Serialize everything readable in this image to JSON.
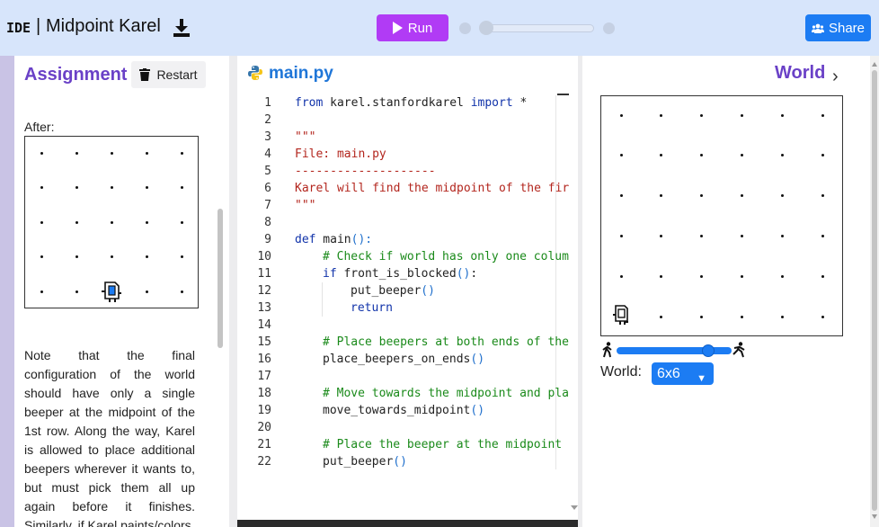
{
  "header": {
    "ide_label": "IDE",
    "separator": "|",
    "project_title": "Midpoint Karel",
    "run_label": "Run",
    "share_label": "Share"
  },
  "assignment": {
    "title": "Assignment",
    "restart_label": "Restart",
    "after_label": "After:",
    "after_world": {
      "cols": 5,
      "rows": 5,
      "karel_col": 3,
      "karel_row": 1,
      "karel_direction": "east",
      "beeper_col": 3,
      "beeper_row": 1
    },
    "text": "Note that the final configuration of the world should have only a single beeper at the midpoint of the 1st row. Along the way, Karel is allowed to place additional beepers wherever it wants to, but must pick them all up again before it finishes. Similarly, if Karel paints/colors"
  },
  "editor": {
    "file_name": "main.py",
    "lines": [
      {
        "n": "1",
        "indent": 0,
        "tokens": [
          [
            "kw",
            "from"
          ],
          [
            "tx",
            " karel.stanfordkarel "
          ],
          [
            "kw",
            "import"
          ],
          [
            "tx",
            " *"
          ]
        ]
      },
      {
        "n": "2",
        "indent": 0,
        "tokens": []
      },
      {
        "n": "3",
        "indent": 0,
        "tokens": [
          [
            "str",
            "\"\"\""
          ]
        ]
      },
      {
        "n": "4",
        "indent": 0,
        "tokens": [
          [
            "str",
            "File: main.py"
          ]
        ]
      },
      {
        "n": "5",
        "indent": 0,
        "tokens": [
          [
            "str",
            "--------------------"
          ]
        ]
      },
      {
        "n": "6",
        "indent": 0,
        "tokens": [
          [
            "str",
            "Karel will find the midpoint of the firs"
          ]
        ]
      },
      {
        "n": "7",
        "indent": 0,
        "tokens": [
          [
            "str",
            "\"\"\""
          ]
        ]
      },
      {
        "n": "8",
        "indent": 0,
        "tokens": []
      },
      {
        "n": "9",
        "indent": 0,
        "tokens": [
          [
            "kw",
            "def"
          ],
          [
            "tx",
            " main"
          ],
          [
            "pn",
            "():"
          ]
        ]
      },
      {
        "n": "10",
        "indent": 1,
        "tokens": [
          [
            "cm",
            "# Check if world has only one column"
          ]
        ]
      },
      {
        "n": "11",
        "indent": 1,
        "tokens": [
          [
            "kw",
            "if"
          ],
          [
            "tx",
            " front_is_blocked"
          ],
          [
            "pn",
            "()"
          ],
          [
            "tx",
            ":"
          ]
        ]
      },
      {
        "n": "12",
        "indent": 2,
        "tokens": [
          [
            "tx",
            "put_beeper"
          ],
          [
            "pn",
            "()"
          ]
        ]
      },
      {
        "n": "13",
        "indent": 2,
        "tokens": [
          [
            "kw",
            "return"
          ]
        ]
      },
      {
        "n": "14",
        "indent": 0,
        "tokens": []
      },
      {
        "n": "15",
        "indent": 1,
        "tokens": [
          [
            "cm",
            "# Place beepers at both ends of the"
          ]
        ]
      },
      {
        "n": "16",
        "indent": 1,
        "tokens": [
          [
            "tx",
            "place_beepers_on_ends"
          ],
          [
            "pn",
            "()"
          ]
        ]
      },
      {
        "n": "17",
        "indent": 0,
        "tokens": []
      },
      {
        "n": "18",
        "indent": 1,
        "tokens": [
          [
            "cm",
            "# Move towards the midpoint and plac"
          ]
        ]
      },
      {
        "n": "19",
        "indent": 1,
        "tokens": [
          [
            "tx",
            "move_towards_midpoint"
          ],
          [
            "pn",
            "()"
          ]
        ]
      },
      {
        "n": "20",
        "indent": 0,
        "tokens": []
      },
      {
        "n": "21",
        "indent": 1,
        "tokens": [
          [
            "cm",
            "# Place the beeper at the midpoint"
          ]
        ]
      },
      {
        "n": "22",
        "indent": 1,
        "tokens": [
          [
            "tx",
            "put_beeper"
          ],
          [
            "pn",
            "()"
          ]
        ]
      }
    ]
  },
  "world": {
    "title": "World",
    "size_label": "World:",
    "size_value": "6x6",
    "cols": 6,
    "rows": 6,
    "karel_col": 1,
    "karel_row": 1,
    "karel_direction": "north",
    "speed_fraction": 0.8
  },
  "colors": {
    "header_bg": "#d7e5fb",
    "run": "#b13bf5",
    "accent_blue": "#1c7cf3",
    "title_purple": "#6a41c7"
  }
}
